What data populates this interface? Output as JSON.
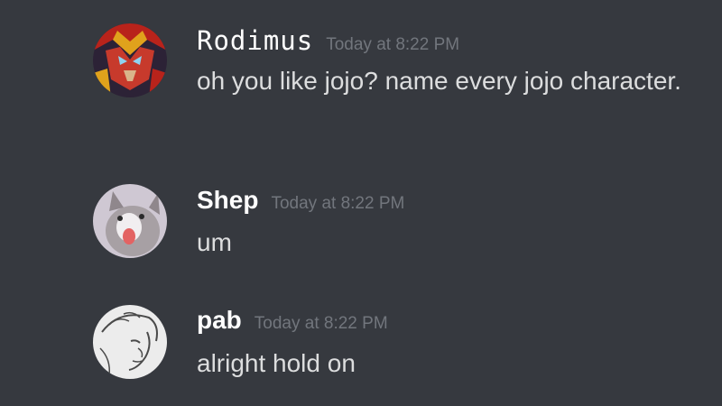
{
  "messages": [
    {
      "username": "Rodimus",
      "timestamp": "Today at 8:22 PM",
      "text": "oh you like jojo? name every jojo character.",
      "avatar_icon": "robot-avatar-icon",
      "avatar_colors": [
        "#b8231b",
        "#e0a21c",
        "#3a2a5a"
      ]
    },
    {
      "username": "Shep",
      "timestamp": "Today at 8:22 PM",
      "text": "um",
      "avatar_icon": "cat-avatar-icon",
      "avatar_colors": [
        "#cfc8d3",
        "#a7a0a4",
        "#e36363"
      ]
    },
    {
      "username": "pab",
      "timestamp": "Today at 8:22 PM",
      "text": "alright hold on",
      "avatar_icon": "sketch-face-avatar-icon",
      "avatar_colors": [
        "#ececec",
        "#4a4a4a"
      ]
    }
  ],
  "theme": {
    "background": "#36393f",
    "username_color": "#ffffff",
    "text_color": "#dcddde",
    "timestamp_color": "#72767d"
  }
}
